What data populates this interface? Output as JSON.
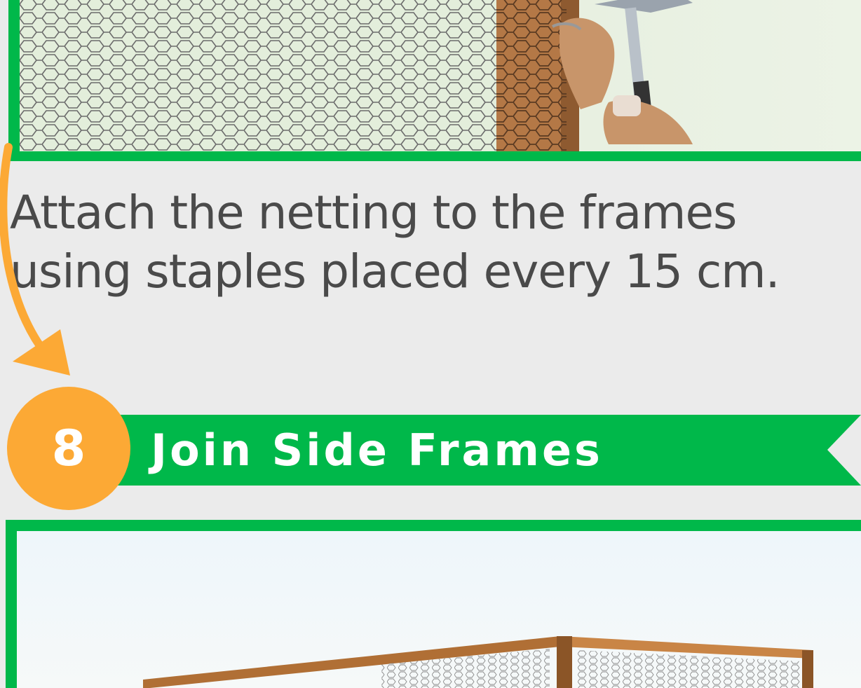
{
  "step7": {
    "caption": "Attach the netting to the frames using staples placed every 15 cm.",
    "illustration_icon": "hammer-stapling-netting-icon"
  },
  "step8": {
    "number": "8",
    "title": "Join Side Frames",
    "illustration_icon": "coop-frame-assembly-icon"
  },
  "colors": {
    "green": "#00b84a",
    "orange": "#fca935",
    "background": "#ebebeb",
    "text": "#4a4a4a"
  }
}
